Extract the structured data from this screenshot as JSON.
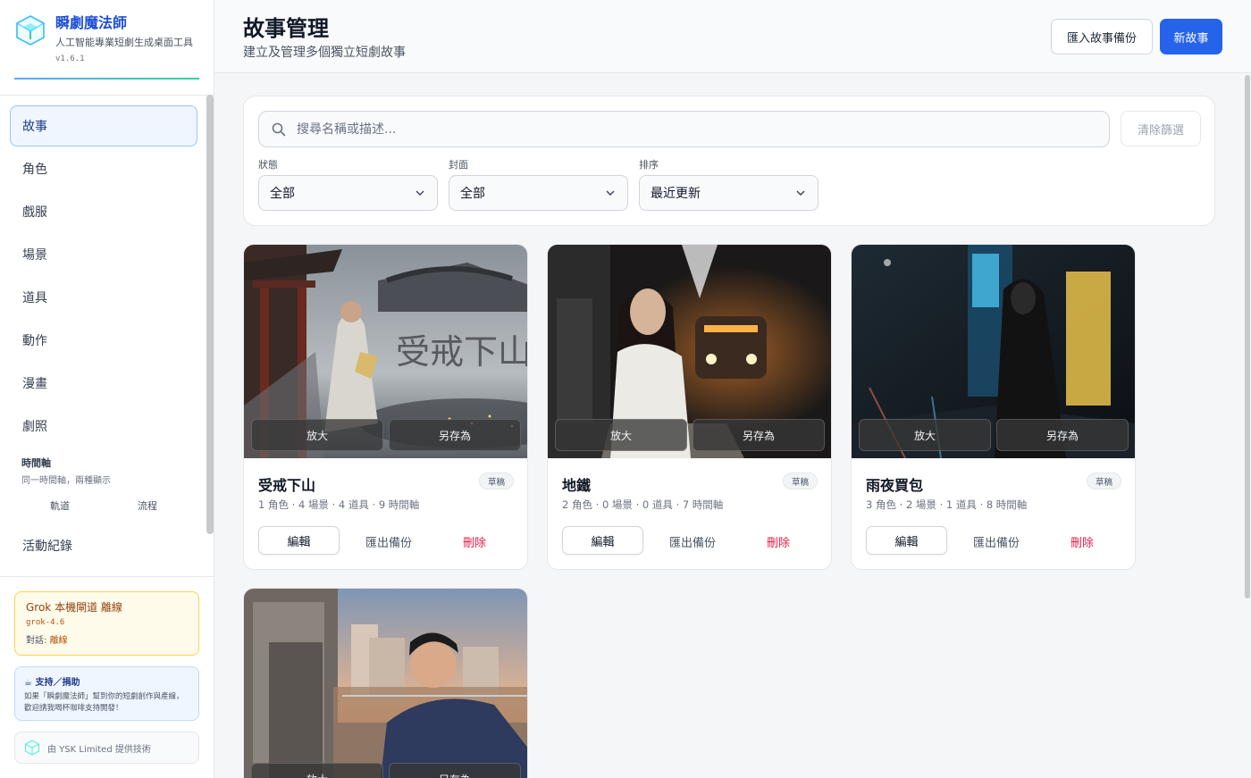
{
  "app": {
    "title": "瞬劇魔法師",
    "subtitle": "人工智能專業短劇生成桌面工具",
    "version": "v1.6.1"
  },
  "nav": {
    "items": [
      "故事",
      "角色",
      "戲服",
      "場景",
      "道具",
      "動作",
      "漫畫",
      "劇照"
    ],
    "active": "故事",
    "timeline": {
      "title": "時間軸",
      "subtitle": "同一時間軸，兩種顯示",
      "links": [
        "軌道",
        "流程"
      ]
    },
    "activity": "活動紀錄"
  },
  "grok": {
    "title": "Grok 本機閘道 離線",
    "model": "grok-4.6",
    "chat_label": "對話:",
    "chat_value": "離線"
  },
  "support": {
    "title": "☕ 支持／捐助",
    "text": "如果「瞬劇魔法師」幫到你的短劇創作與產線，歡迎請我喝杯咖啡支持開發！"
  },
  "credit": "由 YSK Limited 提供技術",
  "header": {
    "title": "故事管理",
    "subtitle": "建立及管理多個獨立短劇故事",
    "import_label": "匯入故事備份",
    "new_label": "新故事"
  },
  "filters": {
    "search_placeholder": "搜尋名稱或描述...",
    "clear_label": "清除篩選",
    "status": {
      "label": "狀態",
      "value": "全部"
    },
    "cover": {
      "label": "封面",
      "value": "全部"
    },
    "sort": {
      "label": "排序",
      "value": "最近更新"
    }
  },
  "card_actions": {
    "zoom": "放大",
    "save_as": "另存為",
    "edit": "編輯",
    "export": "匯出備份",
    "delete": "刪除"
  },
  "stories": [
    {
      "title": "受戒下山",
      "badge": "草稿",
      "meta": "1 角色 · 4 場景 · 4 道具 · 9 時間軸",
      "cover_text": "受戒下山"
    },
    {
      "title": "地鐵",
      "badge": "草稿",
      "meta": "2 角色 · 0 場景 · 0 道具 · 7 時間軸"
    },
    {
      "title": "雨夜買包",
      "badge": "草稿",
      "meta": "3 角色 · 2 場景 · 1 道具 · 8 時間軸"
    },
    {
      "title": "",
      "badge": "",
      "meta": ""
    }
  ],
  "colors": {
    "primary": "#2563eb",
    "danger": "#e11d48",
    "warning_bg": "#fffbeb"
  }
}
